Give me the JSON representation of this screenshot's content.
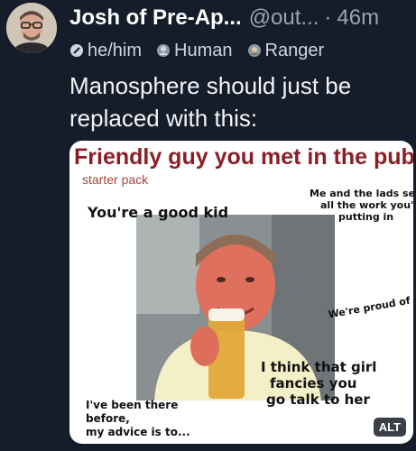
{
  "post": {
    "author": {
      "display_name": "Josh of Pre-Ap...",
      "handle": "@out...",
      "separator": "·",
      "time": "46m"
    },
    "tags": [
      {
        "icon": "info-circle-icon",
        "label": "he/him"
      },
      {
        "icon": "human-badge-icon",
        "label": "Human"
      },
      {
        "icon": "ranger-badge-icon",
        "label": "Ranger"
      }
    ],
    "text_line1": "Manosphere should just be",
    "text_line2": "replaced with this:",
    "media": {
      "title": "Friendly guy you met in the pub",
      "subtitle": "starter pack",
      "captions": {
        "good_kid": "You're a good kid",
        "lads_line1": "Me and the lads see",
        "lads_line2": "all the work you're",
        "lads_line3": "putting in",
        "proud": "We're proud of ya",
        "girl_line1": "I think that girl",
        "girl_line2": "fancies you",
        "girl_line3": "go talk to her",
        "been_line1": "I've been there",
        "been_line2": "before,",
        "been_line3": "my advice is to..."
      },
      "alt_label": "ALT"
    }
  },
  "colors": {
    "background": "#161d2a",
    "title_red": "#8b1f25",
    "muted": "#9aa3b2"
  }
}
